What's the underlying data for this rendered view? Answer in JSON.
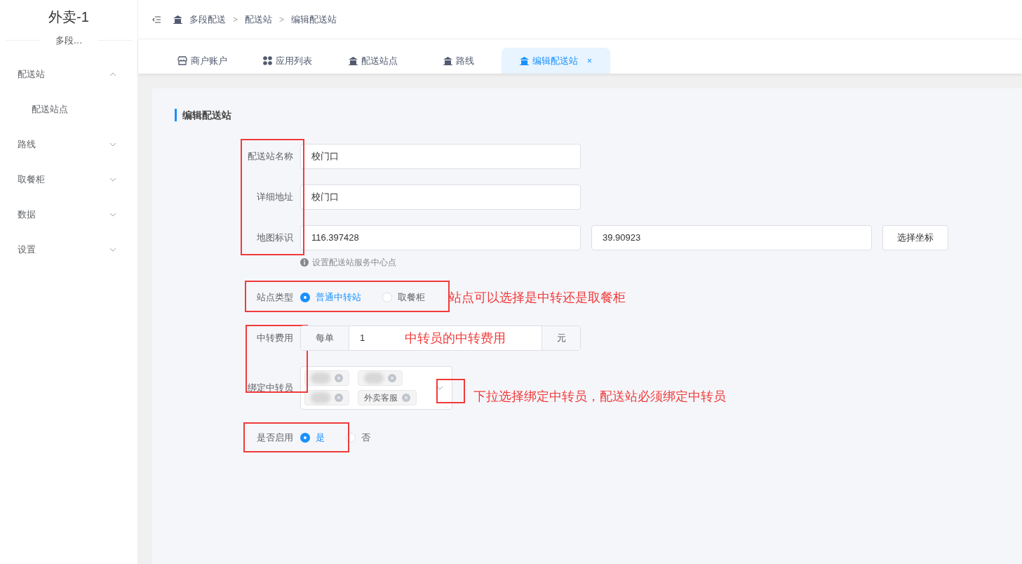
{
  "sidebar": {
    "title": "外卖-1",
    "subtitle": "多段…",
    "items": [
      {
        "label": "配送站",
        "expanded": true,
        "children": [
          {
            "label": "配送站点",
            "selected": false
          }
        ]
      },
      {
        "label": "路线",
        "expanded": false
      },
      {
        "label": "取餐柜",
        "expanded": false
      },
      {
        "label": "数据",
        "expanded": false
      },
      {
        "label": "设置",
        "expanded": false
      }
    ]
  },
  "breadcrumb": [
    {
      "label": "多段配送"
    },
    {
      "separator": ">",
      "label": "配送站"
    },
    {
      "separator": ">",
      "label": "编辑配送站"
    }
  ],
  "tabs": [
    {
      "label": "商户账户",
      "kind": "shop",
      "selected": false
    },
    {
      "label": "应用列表",
      "kind": "apps",
      "selected": false
    },
    {
      "label": "配送站点",
      "kind": "home",
      "selected": false
    },
    {
      "label": "路线",
      "kind": "home",
      "selected": false
    },
    {
      "label": "编辑配送站",
      "kind": "home",
      "selected": true,
      "close": "×"
    }
  ],
  "form": {
    "title": "编辑配送站",
    "name": {
      "label": "配送站名称",
      "value": "校门口"
    },
    "address": {
      "label": "详细地址",
      "value": "校门口"
    },
    "map": {
      "label": "地图标识",
      "longitude": "116.397428",
      "latitude": "39.90923",
      "button": "选择坐标",
      "hint": "设置配送站服务中心点"
    },
    "type": {
      "label": "站点类型",
      "options": [
        {
          "label": "普通中转站",
          "selected": true
        },
        {
          "label": "取餐柜",
          "selected": false
        }
      ]
    },
    "fee": {
      "label": "中转费用",
      "prefix": "每单",
      "value": "1",
      "suffix": "元"
    },
    "couriers": {
      "label": "绑定中转员",
      "tags": [
        {
          "kind": "blurred"
        },
        {
          "kind": "blurred"
        },
        {
          "kind": "blurred"
        },
        {
          "kind": "text",
          "label": "外卖客服"
        }
      ]
    },
    "enabled": {
      "label": "是否启用",
      "options": [
        {
          "label": "是",
          "selected": true
        },
        {
          "label": "否",
          "selected": false
        }
      ]
    }
  },
  "annotations": [
    "站点可以选择是中转还是取餐柜",
    "中转员的中转费用",
    "下拉选择绑定中转员，配送站必须绑定中转员"
  ]
}
